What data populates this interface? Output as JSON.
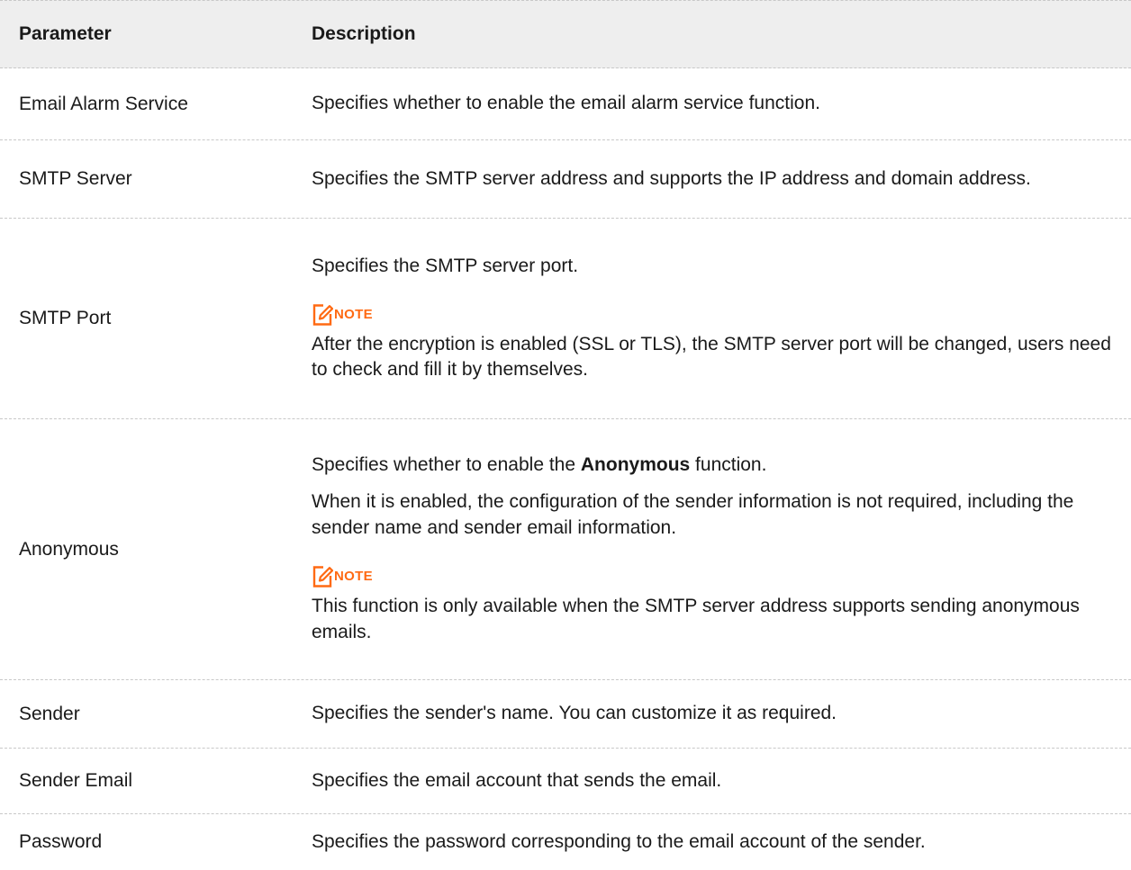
{
  "header": {
    "parameter": "Parameter",
    "description": "Description"
  },
  "rows": [
    {
      "parameter": "Email Alarm Service",
      "description": "Specifies whether to enable the email alarm service function."
    },
    {
      "parameter": "SMTP Server",
      "description": "Specifies the SMTP server address and supports the IP address and domain address."
    },
    {
      "parameter": "SMTP Port",
      "description": "Specifies the SMTP server port.",
      "note_label": "NOTE",
      "note_text": "After the encryption is enabled (SSL or TLS), the SMTP server port will be changed, users need to check and fill it by themselves."
    },
    {
      "parameter": "Anonymous",
      "description_before": "Specifies whether to enable the ",
      "description_bold": "Anonymous",
      "description_after": " function.",
      "description2": "When it is enabled, the configuration of the sender information is not required, including the sender name and sender email information.",
      "note_label": "NOTE",
      "note_text": "This function is only available when the SMTP server address supports sending anonymous emails."
    },
    {
      "parameter": "Sender",
      "description": "Specifies the sender's name. You can customize it as required."
    },
    {
      "parameter": "Sender Email",
      "description": "Specifies the email account that sends the email."
    },
    {
      "parameter": "Password",
      "description": "Specifies the password corresponding to the email account of the sender."
    }
  ],
  "colors": {
    "note_accent": "#ff6a13",
    "header_bg": "#eeeeee",
    "divider": "#c8c8c8"
  },
  "icons": {
    "note": "note-pencil-icon"
  }
}
